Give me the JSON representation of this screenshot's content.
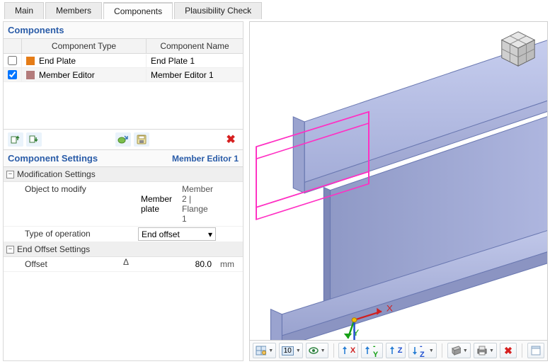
{
  "tabs": {
    "main": "Main",
    "members": "Members",
    "components": "Components",
    "plausibility": "Plausibility Check",
    "active": "components"
  },
  "components": {
    "panel_title": "Components",
    "headers": {
      "type": "Component Type",
      "name": "Component Name"
    },
    "rows": [
      {
        "checked": false,
        "swatch": "#e57c17",
        "type": "End Plate",
        "name": "End Plate 1"
      },
      {
        "checked": true,
        "swatch": "#b37b7b",
        "type": "Member Editor",
        "name": "Member Editor 1"
      }
    ]
  },
  "settings": {
    "panel_title": "Component Settings",
    "context": "Member Editor 1",
    "groups": {
      "modification": {
        "title": "Modification Settings",
        "object_label": "Object to modify",
        "object_value": "Member plate",
        "object_ref": "Member 2 | Flange 1",
        "operation_label": "Type of operation",
        "operation_value": "End offset"
      },
      "end_offset": {
        "title": "End Offset Settings",
        "offset_label": "Offset",
        "delta": "Δ",
        "offset_value": "80.0",
        "offset_unit": "mm"
      }
    }
  },
  "viewport": {
    "axes": {
      "x": "X",
      "y": "Y",
      "z": "Z"
    },
    "toolbar": {
      "iso_num": "10"
    }
  },
  "colors": {
    "beam_face": "#b2bbe3",
    "beam_edge": "#6a78b1",
    "highlight": "#ff2fc3"
  }
}
